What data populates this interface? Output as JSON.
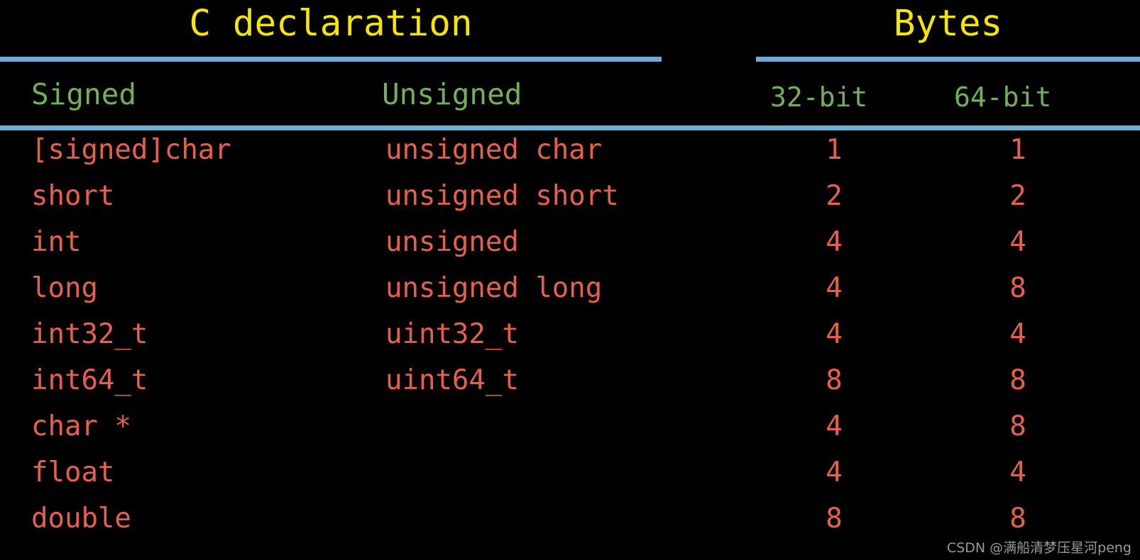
{
  "colors": {
    "background": "#000000",
    "title": "#f6e500",
    "column_header": "#72b05c",
    "body_text": "#e8604c",
    "rule": "#6aaed6",
    "watermark": "#9a9a9a"
  },
  "table": {
    "group_headers": [
      {
        "label": "C declaration",
        "spans": [
          "Signed",
          "Unsigned"
        ]
      },
      {
        "label": "Bytes",
        "spans": [
          "32-bit",
          "64-bit"
        ]
      }
    ],
    "title_c_declaration": "C declaration",
    "title_bytes": "Bytes",
    "columns": [
      {
        "key": "signed",
        "label": "Signed"
      },
      {
        "key": "unsigned",
        "label": "Unsigned"
      },
      {
        "key": "b32",
        "label": "32-bit"
      },
      {
        "key": "b64",
        "label": "64-bit"
      }
    ],
    "rows": [
      {
        "signed": "[signed]char",
        "unsigned": "unsigned char",
        "b32": "1",
        "b64": "1"
      },
      {
        "signed": "short",
        "unsigned": "unsigned short",
        "b32": "2",
        "b64": "2"
      },
      {
        "signed": "int",
        "unsigned": "unsigned",
        "b32": "4",
        "b64": "4"
      },
      {
        "signed": "long",
        "unsigned": "unsigned long",
        "b32": "4",
        "b64": "8"
      },
      {
        "signed": "int32_t",
        "unsigned": "uint32_t",
        "b32": "4",
        "b64": "4"
      },
      {
        "signed": "int64_t",
        "unsigned": "uint64_t",
        "b32": "8",
        "b64": "8"
      },
      {
        "signed": "char *",
        "unsigned": "",
        "b32": "4",
        "b64": "8"
      },
      {
        "signed": "float",
        "unsigned": "",
        "b32": "4",
        "b64": "4"
      },
      {
        "signed": "double",
        "unsigned": "",
        "b32": "8",
        "b64": "8"
      }
    ]
  },
  "watermark": {
    "text": "CSDN @满船清梦压星河peng"
  },
  "chart_data": {
    "type": "table",
    "title": "C declaration / Bytes",
    "columns": [
      "Signed",
      "Unsigned",
      "32-bit",
      "64-bit"
    ],
    "column_groups": [
      {
        "label": "C declaration",
        "columns": [
          "Signed",
          "Unsigned"
        ]
      },
      {
        "label": "Bytes",
        "columns": [
          "32-bit",
          "64-bit"
        ]
      }
    ],
    "rows": [
      [
        "[signed]char",
        "unsigned char",
        "1",
        "1"
      ],
      [
        "short",
        "unsigned short",
        "2",
        "2"
      ],
      [
        "int",
        "unsigned",
        "4",
        "4"
      ],
      [
        "long",
        "unsigned long",
        "4",
        "8"
      ],
      [
        "int32_t",
        "uint32_t",
        "4",
        "4"
      ],
      [
        "int64_t",
        "uint64_t",
        "8",
        "8"
      ],
      [
        "char *",
        "",
        "4",
        "8"
      ],
      [
        "float",
        "",
        "4",
        "4"
      ],
      [
        "double",
        "",
        "8",
        "8"
      ]
    ]
  }
}
